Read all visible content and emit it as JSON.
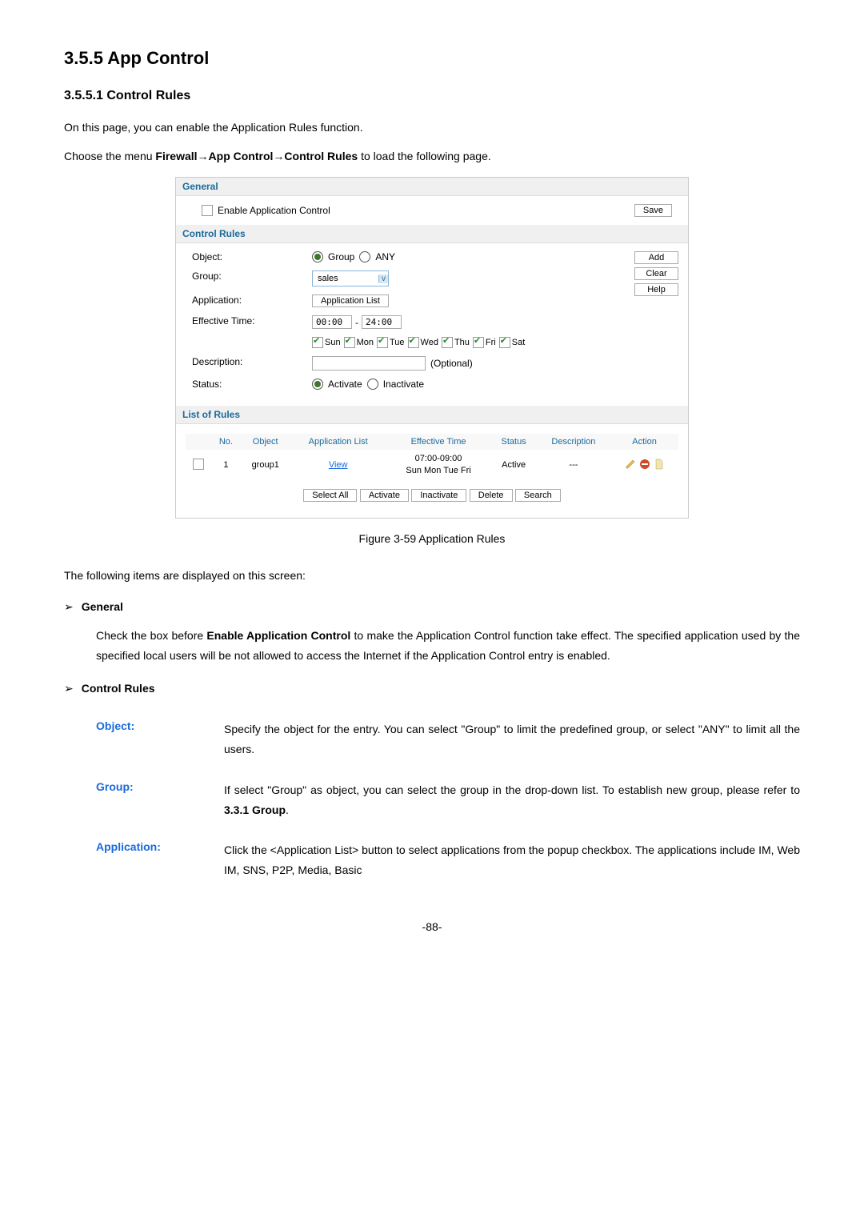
{
  "heading1": "3.5.5  App Control",
  "heading2": "3.5.5.1    Control Rules",
  "intro": "On this page, you can enable the Application Rules function.",
  "path_prefix": "Choose the menu ",
  "path_bold": "Firewall→App Control→Control Rules",
  "path_suffix": " to load the following page.",
  "screenshot": {
    "general_header": "General",
    "enable_label": "Enable Application Control",
    "save_btn": "Save",
    "control_header": "Control Rules",
    "object_label": "Object:",
    "object_group": "Group",
    "object_any": "ANY",
    "group_label": "Group:",
    "group_value": "sales",
    "application_label": "Application:",
    "app_list_btn": "Application List",
    "effective_label": "Effective Time:",
    "time_from": "00:00",
    "time_sep": "-",
    "time_to": "24:00",
    "days": [
      "Sun",
      "Mon",
      "Tue",
      "Wed",
      "Thu",
      "Fri",
      "Sat"
    ],
    "description_label": "Description:",
    "optional": "(Optional)",
    "status_label": "Status:",
    "status_activate": "Activate",
    "status_inactivate": "Inactivate",
    "add_btn": "Add",
    "clear_btn": "Clear",
    "help_btn": "Help",
    "list_header": "List of Rules",
    "th": {
      "no": "No.",
      "object": "Object",
      "app": "Application List",
      "etime": "Effective Time",
      "status": "Status",
      "desc": "Description",
      "action": "Action"
    },
    "row": {
      "no": "1",
      "object": "group1",
      "app": "View",
      "etime1": "07:00-09:00",
      "etime2": "Sun Mon Tue Fri",
      "status": "Active",
      "desc": "---"
    },
    "btns": [
      "Select All",
      "Activate",
      "Inactivate",
      "Delete",
      "Search"
    ]
  },
  "caption": "Figure 3-59 Application Rules",
  "after_caption": "The following items are displayed on this screen:",
  "bullets": {
    "general": "General",
    "general_desc_pre": "Check the box before ",
    "general_desc_bold": "Enable Application Control",
    "general_desc_post": " to make the Application Control function take effect. The specified application used by the specified local users will be not allowed to access the Internet if the Application Control entry is enabled.",
    "control": "Control Rules"
  },
  "fields": {
    "object": {
      "label": "Object:",
      "desc": "Specify the object for the entry. You can select \"Group\" to limit the predefined group, or select \"ANY\" to limit all the users."
    },
    "group": {
      "label": "Group:",
      "desc_pre": "If select \"Group\" as object, you can select the group in the drop-down list. To establish new group, please refer to ",
      "desc_bold": "3.3.1 Group",
      "desc_post": "."
    },
    "application": {
      "label": "Application:",
      "desc": "Click the <Application List> button to select applications from the popup checkbox. The applications include IM, Web IM, SNS, P2P, Media, Basic"
    }
  },
  "page_num": "-88-"
}
